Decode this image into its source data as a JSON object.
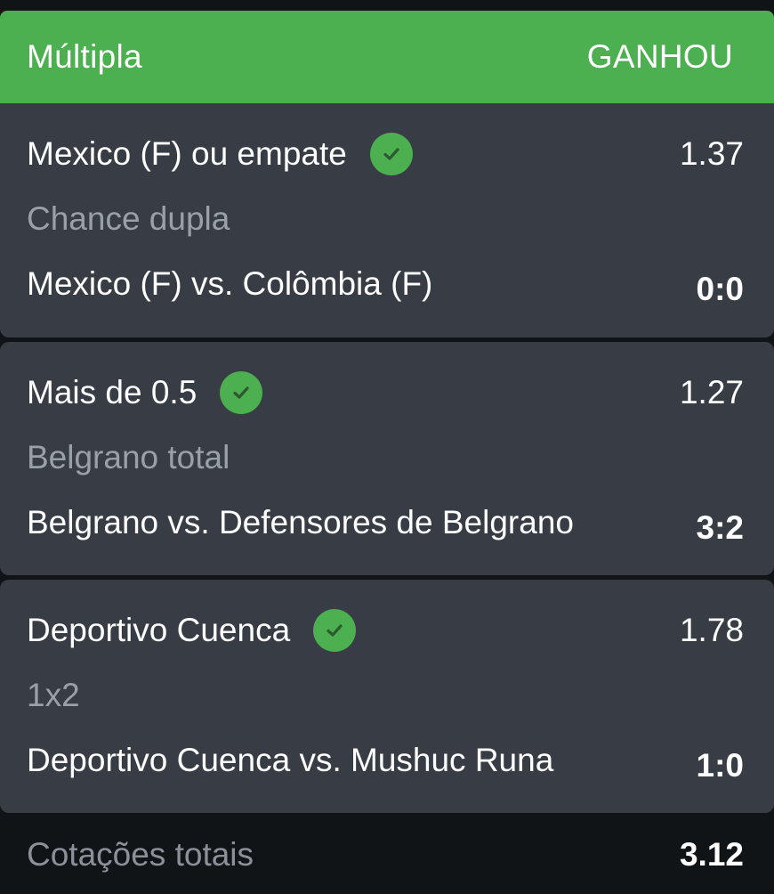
{
  "header": {
    "title": "Múltipla",
    "status": "GANHOU",
    "status_color": "#4caf50"
  },
  "selections": [
    {
      "pick": "Mexico (F) ou empate",
      "odds": "1.37",
      "market": "Chance dupla",
      "event": "Mexico (F) vs. Colômbia (F)",
      "score": "0:0",
      "result_icon": "check-circle-icon"
    },
    {
      "pick": "Mais de 0.5",
      "odds": "1.27",
      "market": "Belgrano total",
      "event": "Belgrano vs. Defensores de Belgrano",
      "score": "3:2",
      "result_icon": "check-circle-icon"
    },
    {
      "pick": "Deportivo Cuenca",
      "odds": "1.78",
      "market": "1x2",
      "event": "Deportivo Cuenca vs. Mushuc Runa",
      "score": "1:0",
      "result_icon": "check-circle-icon"
    }
  ],
  "footer": {
    "label": "Cotações totais",
    "total_odds": "3.12"
  }
}
